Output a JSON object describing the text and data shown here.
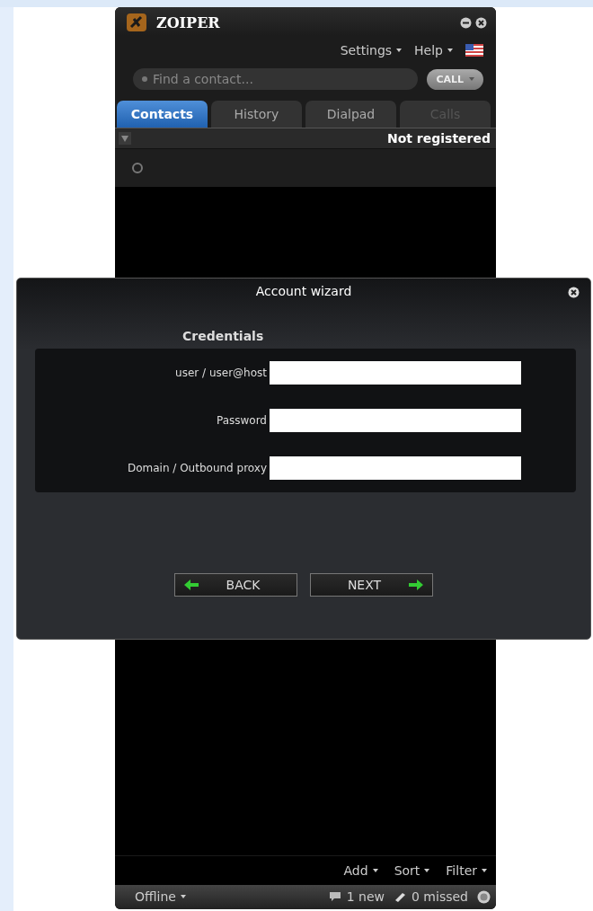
{
  "window": {
    "title": "ZOIPER"
  },
  "menu": [
    {
      "label": "Settings"
    },
    {
      "label": "Help"
    }
  ],
  "search": {
    "placeholder": "Find a contact..."
  },
  "call_button": {
    "label": "CALL"
  },
  "tabs": [
    {
      "label": "Contacts",
      "selected": true,
      "disabled": false
    },
    {
      "label": "History",
      "selected": false,
      "disabled": false
    },
    {
      "label": "Dialpad",
      "selected": false,
      "disabled": false
    },
    {
      "label": "Calls",
      "selected": false,
      "disabled": true
    }
  ],
  "registration_status": "Not registered",
  "contacts": [
    {
      "online": false
    }
  ],
  "toolbar": [
    {
      "label": "Add"
    },
    {
      "label": "Sort"
    },
    {
      "label": "Filter"
    }
  ],
  "status_bar": {
    "presence": "Offline",
    "messages": "1 new",
    "missed_calls": "0 missed"
  },
  "wizard": {
    "title": "Account wizard",
    "section": "Credentials",
    "fields": [
      {
        "label": "user / user@host"
      },
      {
        "label": "Password"
      },
      {
        "label": "Domain / Outbound proxy"
      }
    ],
    "buttons": [
      {
        "label": "BACK",
        "kind": "back"
      },
      {
        "label": "NEXT",
        "kind": "next"
      }
    ]
  }
}
